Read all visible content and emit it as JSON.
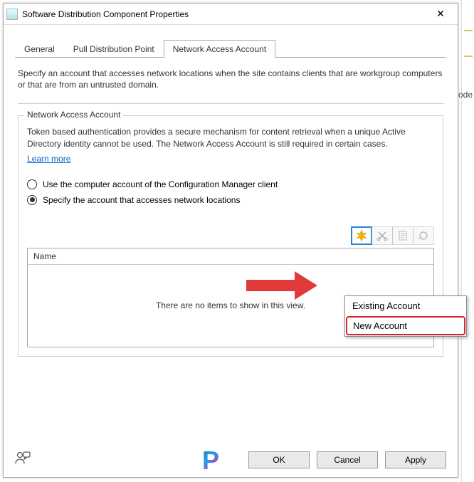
{
  "window": {
    "title": "Software Distribution Component Properties"
  },
  "tabs": {
    "items": [
      {
        "label": "General",
        "active": false
      },
      {
        "label": "Pull Distribution Point",
        "active": false
      },
      {
        "label": "Network Access Account",
        "active": true
      }
    ]
  },
  "panel": {
    "intro": "Specify an account that accesses network locations when the site contains clients that are workgroup computers or that are from an untrusted domain.",
    "group_legend": "Network Access Account",
    "group_desc": "Token based authentication provides a secure mechanism for content retrieval when a unique Active Directory identity cannot be used. The Network Access Account is still required in certain cases.",
    "learn_more": "Learn more",
    "radio_computer": "Use the computer account of the Configuration Manager client",
    "radio_specify": "Specify the account that accesses network locations",
    "list_header": "Name",
    "list_empty": "There are no items to show in this view."
  },
  "toolbar_icons": {
    "new": "new-starburst-icon",
    "delete": "scissors-icon",
    "properties": "properties-icon",
    "refresh": "refresh-icon"
  },
  "dropdown": {
    "items": [
      {
        "label": "Existing Account",
        "highlighted": false
      },
      {
        "label": "New Account",
        "highlighted": true
      }
    ]
  },
  "buttons": {
    "ok": "OK",
    "cancel": "Cancel",
    "apply": "Apply"
  },
  "background": {
    "partial_text": "ode"
  }
}
